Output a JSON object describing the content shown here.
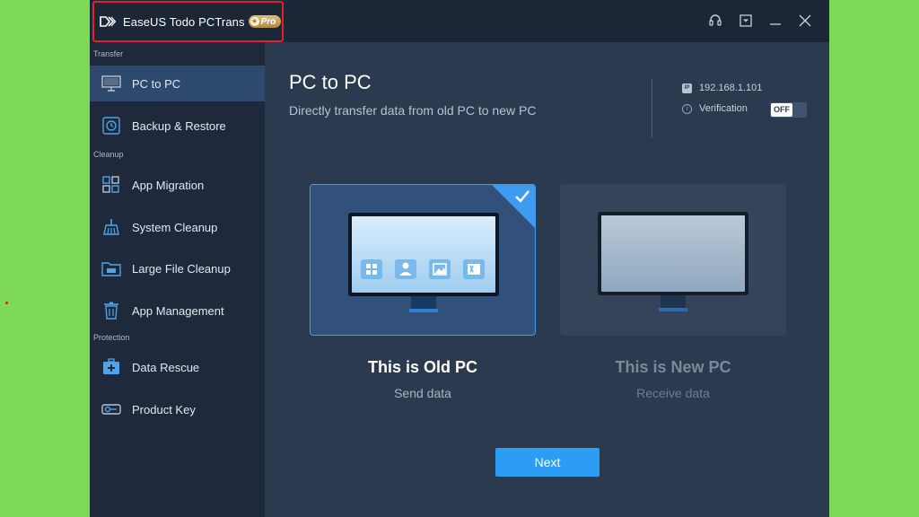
{
  "app": {
    "name": "EaseUS Todo PCTrans",
    "badge": "Pro"
  },
  "sidebar": {
    "sections": [
      {
        "label": "Transfer"
      },
      {
        "label": "Cleanup"
      },
      {
        "label": "Protection"
      }
    ],
    "items": [
      {
        "label": "PC to PC",
        "icon": "monitor-icon",
        "active": true
      },
      {
        "label": "Backup & Restore",
        "icon": "backup-icon"
      },
      {
        "label": "App Migration",
        "icon": "app-grid-icon"
      },
      {
        "label": "System Cleanup",
        "icon": "broom-icon"
      },
      {
        "label": "Large File Cleanup",
        "icon": "folder-gb-icon"
      },
      {
        "label": "App Management",
        "icon": "trash-icon"
      },
      {
        "label": "Data Rescue",
        "icon": "medkit-icon"
      },
      {
        "label": "Product Key",
        "icon": "key-icon"
      }
    ]
  },
  "main": {
    "title": "PC to PC",
    "subtitle": "Directly transfer data from old PC to new PC",
    "ip_address": "192.168.1.101",
    "ip_icon_label": "IP",
    "verification_label": "Verification",
    "verification_toggle": "OFF",
    "old_pc": {
      "title": "This is Old PC",
      "subtitle": "Send data",
      "selected": true
    },
    "new_pc": {
      "title": "This is New PC",
      "subtitle": "Receive data",
      "selected": false
    },
    "next_label": "Next"
  },
  "colors": {
    "accent": "#2d9cf5",
    "sidebar_bg": "#1e2a3c",
    "main_bg": "#2c3a4f",
    "highlight_border": "#e0202c"
  }
}
